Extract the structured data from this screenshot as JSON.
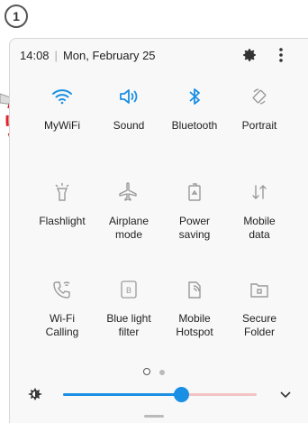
{
  "step_number": "1",
  "status": {
    "time": "14:08",
    "separator": "|",
    "date": "Mon, February 25"
  },
  "tiles": [
    {
      "label": "MyWiFi",
      "icon": "wifi-icon",
      "active": true
    },
    {
      "label": "Sound",
      "icon": "sound-icon",
      "active": true
    },
    {
      "label": "Bluetooth",
      "icon": "bluetooth-icon",
      "active": true
    },
    {
      "label": "Portrait",
      "icon": "portrait-rotate-icon",
      "active": false
    },
    {
      "label": "Flashlight",
      "icon": "flashlight-icon",
      "active": false
    },
    {
      "label": "Airplane mode",
      "icon": "airplane-icon",
      "active": false
    },
    {
      "label": "Power saving",
      "icon": "power-saving-icon",
      "active": false
    },
    {
      "label": "Mobile data",
      "icon": "mobile-data-icon",
      "active": false
    },
    {
      "label": "Wi-Fi Calling",
      "icon": "wifi-calling-icon",
      "active": false
    },
    {
      "label": "Blue light filter",
      "icon": "blue-light-filter-icon",
      "active": false
    },
    {
      "label": "Mobile Hotspot",
      "icon": "mobile-hotspot-icon",
      "active": false
    },
    {
      "label": "Secure Folder",
      "icon": "secure-folder-icon",
      "active": false
    }
  ],
  "brightness": {
    "level": 0.61
  },
  "page_indicator": {
    "current": 1,
    "total": 2
  },
  "colors": {
    "active": "#1a8fe3",
    "inactive": "#9a9a9a",
    "highlight": "#e0242b"
  }
}
